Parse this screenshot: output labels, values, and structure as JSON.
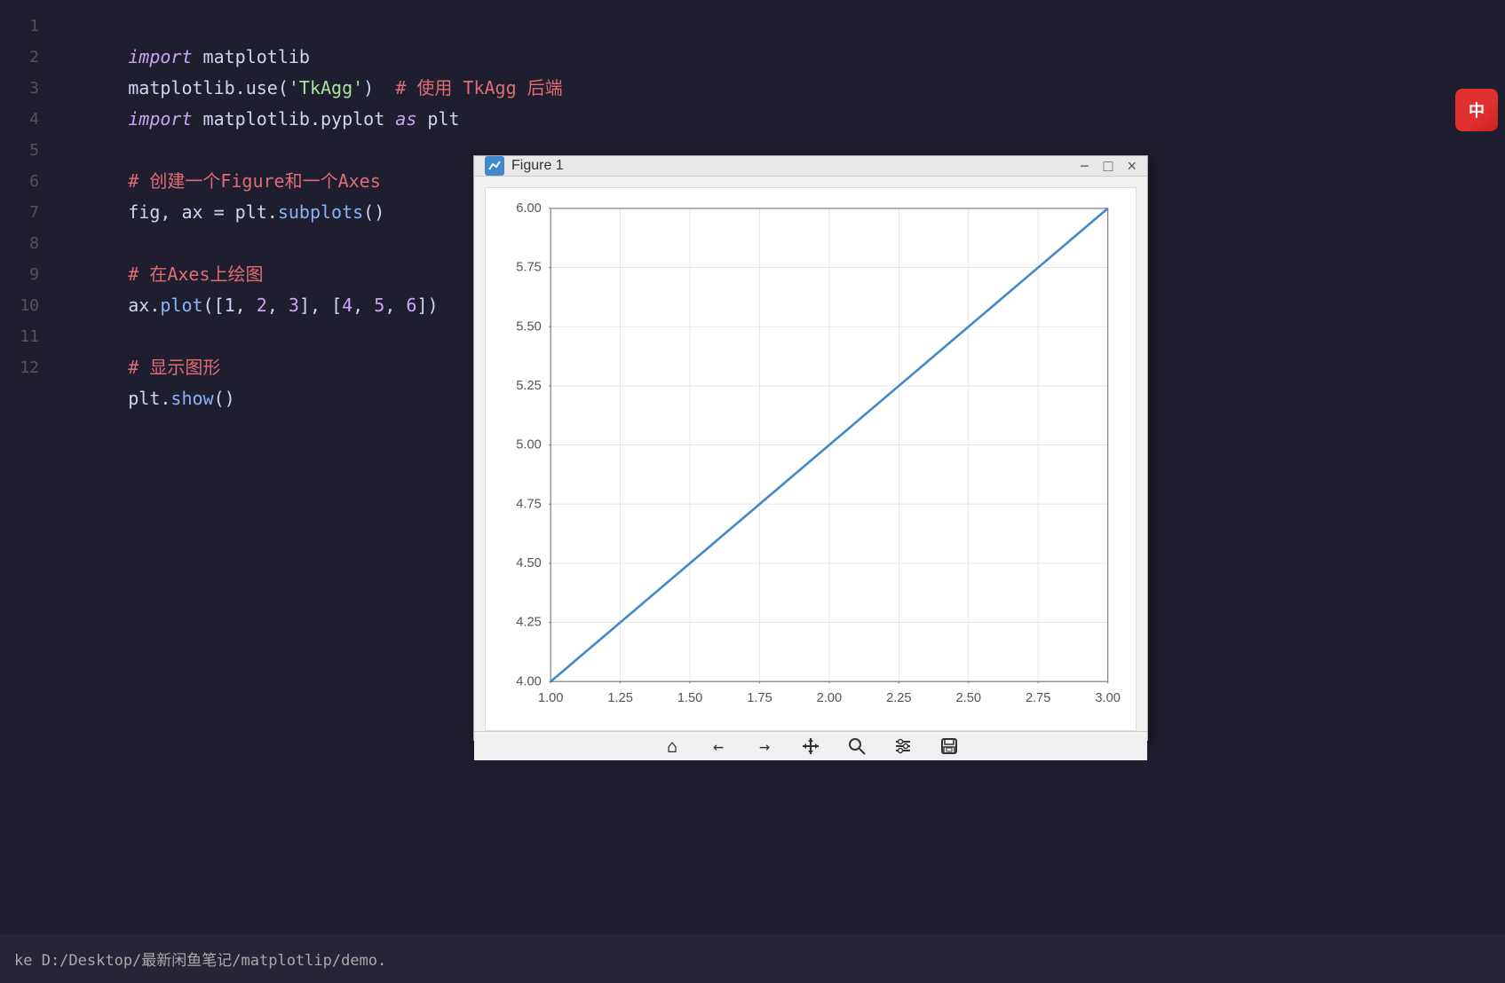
{
  "editor": {
    "lines": [
      {
        "num": 1,
        "tokens": [
          {
            "text": "import",
            "class": "kw"
          },
          {
            "text": " matplotlib",
            "class": "plain"
          }
        ]
      },
      {
        "num": 2,
        "tokens": [
          {
            "text": "matplotlib",
            "class": "plain"
          },
          {
            "text": ".use(",
            "class": "plain"
          },
          {
            "text": "'TkAgg'",
            "class": "str"
          },
          {
            "text": ")  ",
            "class": "plain"
          },
          {
            "text": "# 使用 TkAgg 后端",
            "class": "comment"
          }
        ]
      },
      {
        "num": 3,
        "tokens": [
          {
            "text": "import",
            "class": "kw"
          },
          {
            "text": " matplotlib.pyplot ",
            "class": "plain"
          },
          {
            "text": "as",
            "class": "kw"
          },
          {
            "text": " plt",
            "class": "plain"
          }
        ]
      },
      {
        "num": 4,
        "tokens": []
      },
      {
        "num": 5,
        "tokens": [
          {
            "text": "# 创建一个Figure和一个Axes",
            "class": "comment"
          }
        ]
      },
      {
        "num": 6,
        "tokens": [
          {
            "text": "fig, ax = plt.",
            "class": "plain"
          },
          {
            "text": "subplots",
            "class": "fn"
          },
          {
            "text": "()",
            "class": "plain"
          }
        ]
      },
      {
        "num": 7,
        "tokens": []
      },
      {
        "num": 8,
        "tokens": [
          {
            "text": "# 在Axes上绘图",
            "class": "comment"
          }
        ]
      },
      {
        "num": 9,
        "tokens": [
          {
            "text": "ax.",
            "class": "plain"
          },
          {
            "text": "plot",
            "class": "fn"
          },
          {
            "text": "([1, ",
            "class": "plain"
          },
          {
            "text": "2",
            "class": "num"
          },
          {
            "text": ", ",
            "class": "plain"
          },
          {
            "text": "3",
            "class": "num"
          },
          {
            "text": "], [",
            "class": "plain"
          },
          {
            "text": "4",
            "class": "num"
          },
          {
            "text": ", ",
            "class": "plain"
          },
          {
            "text": "5",
            "class": "num"
          },
          {
            "text": ", ",
            "class": "plain"
          },
          {
            "text": "6",
            "class": "num"
          },
          {
            "text": "])",
            "class": "plain"
          }
        ]
      },
      {
        "num": 10,
        "tokens": []
      },
      {
        "num": 11,
        "tokens": [
          {
            "text": "# 显示图形",
            "class": "comment"
          }
        ]
      },
      {
        "num": 12,
        "tokens": [
          {
            "text": "plt.",
            "class": "plain"
          },
          {
            "text": "show",
            "class": "fn"
          },
          {
            "text": "()",
            "class": "plain"
          }
        ]
      }
    ]
  },
  "figure": {
    "title": "Figure 1",
    "yaxis": [
      "6.00",
      "5.75",
      "5.50",
      "5.25",
      "5.00",
      "4.75",
      "4.50",
      "4.25",
      "4.00"
    ],
    "xaxis": [
      "1.00",
      "1.25",
      "1.50",
      "1.75",
      "2.00",
      "2.25",
      "2.50",
      "2.75",
      "3.00"
    ]
  },
  "statusbar": {
    "text": "ke D:/Desktop/最新闲鱼笔记/matplotlip/demo."
  },
  "sogou": {
    "label": "中"
  },
  "toolbar": {
    "home": "⌂",
    "back": "←",
    "forward": "→",
    "pan": "✛",
    "zoom": "🔍",
    "config": "⚙",
    "save": "💾"
  }
}
